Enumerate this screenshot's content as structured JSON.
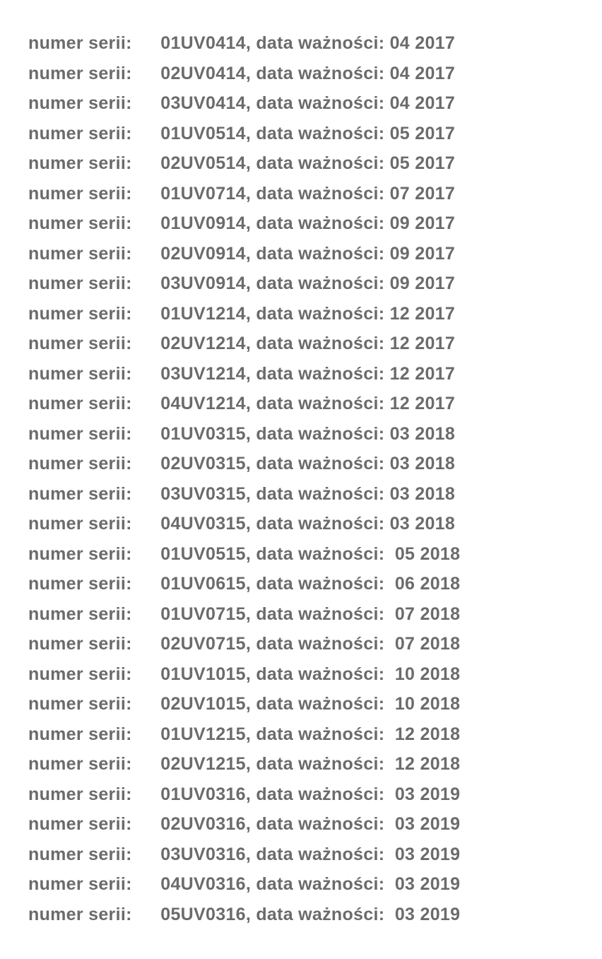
{
  "labels": {
    "serii": "numer serii:",
    "waznosci": "data ważności:"
  },
  "rows": [
    {
      "serial": "01UV0414",
      "date": "04 2017",
      "space": " "
    },
    {
      "serial": "02UV0414",
      "date": "04 2017",
      "space": " "
    },
    {
      "serial": "03UV0414",
      "date": "04 2017",
      "space": " "
    },
    {
      "serial": "01UV0514",
      "date": "05 2017",
      "space": " "
    },
    {
      "serial": "02UV0514",
      "date": "05 2017",
      "space": " "
    },
    {
      "serial": "01UV0714",
      "date": "07 2017",
      "space": " "
    },
    {
      "serial": "01UV0914",
      "date": "09 2017",
      "space": " "
    },
    {
      "serial": "02UV0914",
      "date": "09 2017",
      "space": " "
    },
    {
      "serial": "03UV0914",
      "date": "09 2017",
      "space": " "
    },
    {
      "serial": "01UV1214",
      "date": "12 2017",
      "space": " "
    },
    {
      "serial": "02UV1214",
      "date": "12 2017",
      "space": " "
    },
    {
      "serial": "03UV1214",
      "date": "12 2017",
      "space": " "
    },
    {
      "serial": "04UV1214",
      "date": "12 2017",
      "space": " "
    },
    {
      "serial": "01UV0315",
      "date": "03 2018",
      "space": " "
    },
    {
      "serial": "02UV0315",
      "date": "03 2018",
      "space": " "
    },
    {
      "serial": "03UV0315",
      "date": "03 2018",
      "space": " "
    },
    {
      "serial": "04UV0315",
      "date": "03 2018",
      "space": " "
    },
    {
      "serial": "01UV0515",
      "date": "05 2018",
      "space": "  "
    },
    {
      "serial": "01UV0615",
      "date": "06 2018",
      "space": "  "
    },
    {
      "serial": "01UV0715",
      "date": "07 2018",
      "space": "  "
    },
    {
      "serial": "02UV0715",
      "date": "07 2018",
      "space": "  "
    },
    {
      "serial": "01UV1015",
      "date": "10 2018",
      "space": "  "
    },
    {
      "serial": "02UV1015",
      "date": "10 2018",
      "space": "  "
    },
    {
      "serial": "01UV1215",
      "date": "12 2018",
      "space": "  "
    },
    {
      "serial": "02UV1215",
      "date": "12 2018",
      "space": "  "
    },
    {
      "serial": "01UV0316",
      "date": "03 2019",
      "space": "  "
    },
    {
      "serial": "02UV0316",
      "date": "03 2019",
      "space": "  "
    },
    {
      "serial": "03UV0316",
      "date": "03 2019",
      "space": "  "
    },
    {
      "serial": "04UV0316",
      "date": "03 2019",
      "space": "  "
    },
    {
      "serial": "05UV0316",
      "date": "03 2019",
      "space": "  "
    }
  ]
}
